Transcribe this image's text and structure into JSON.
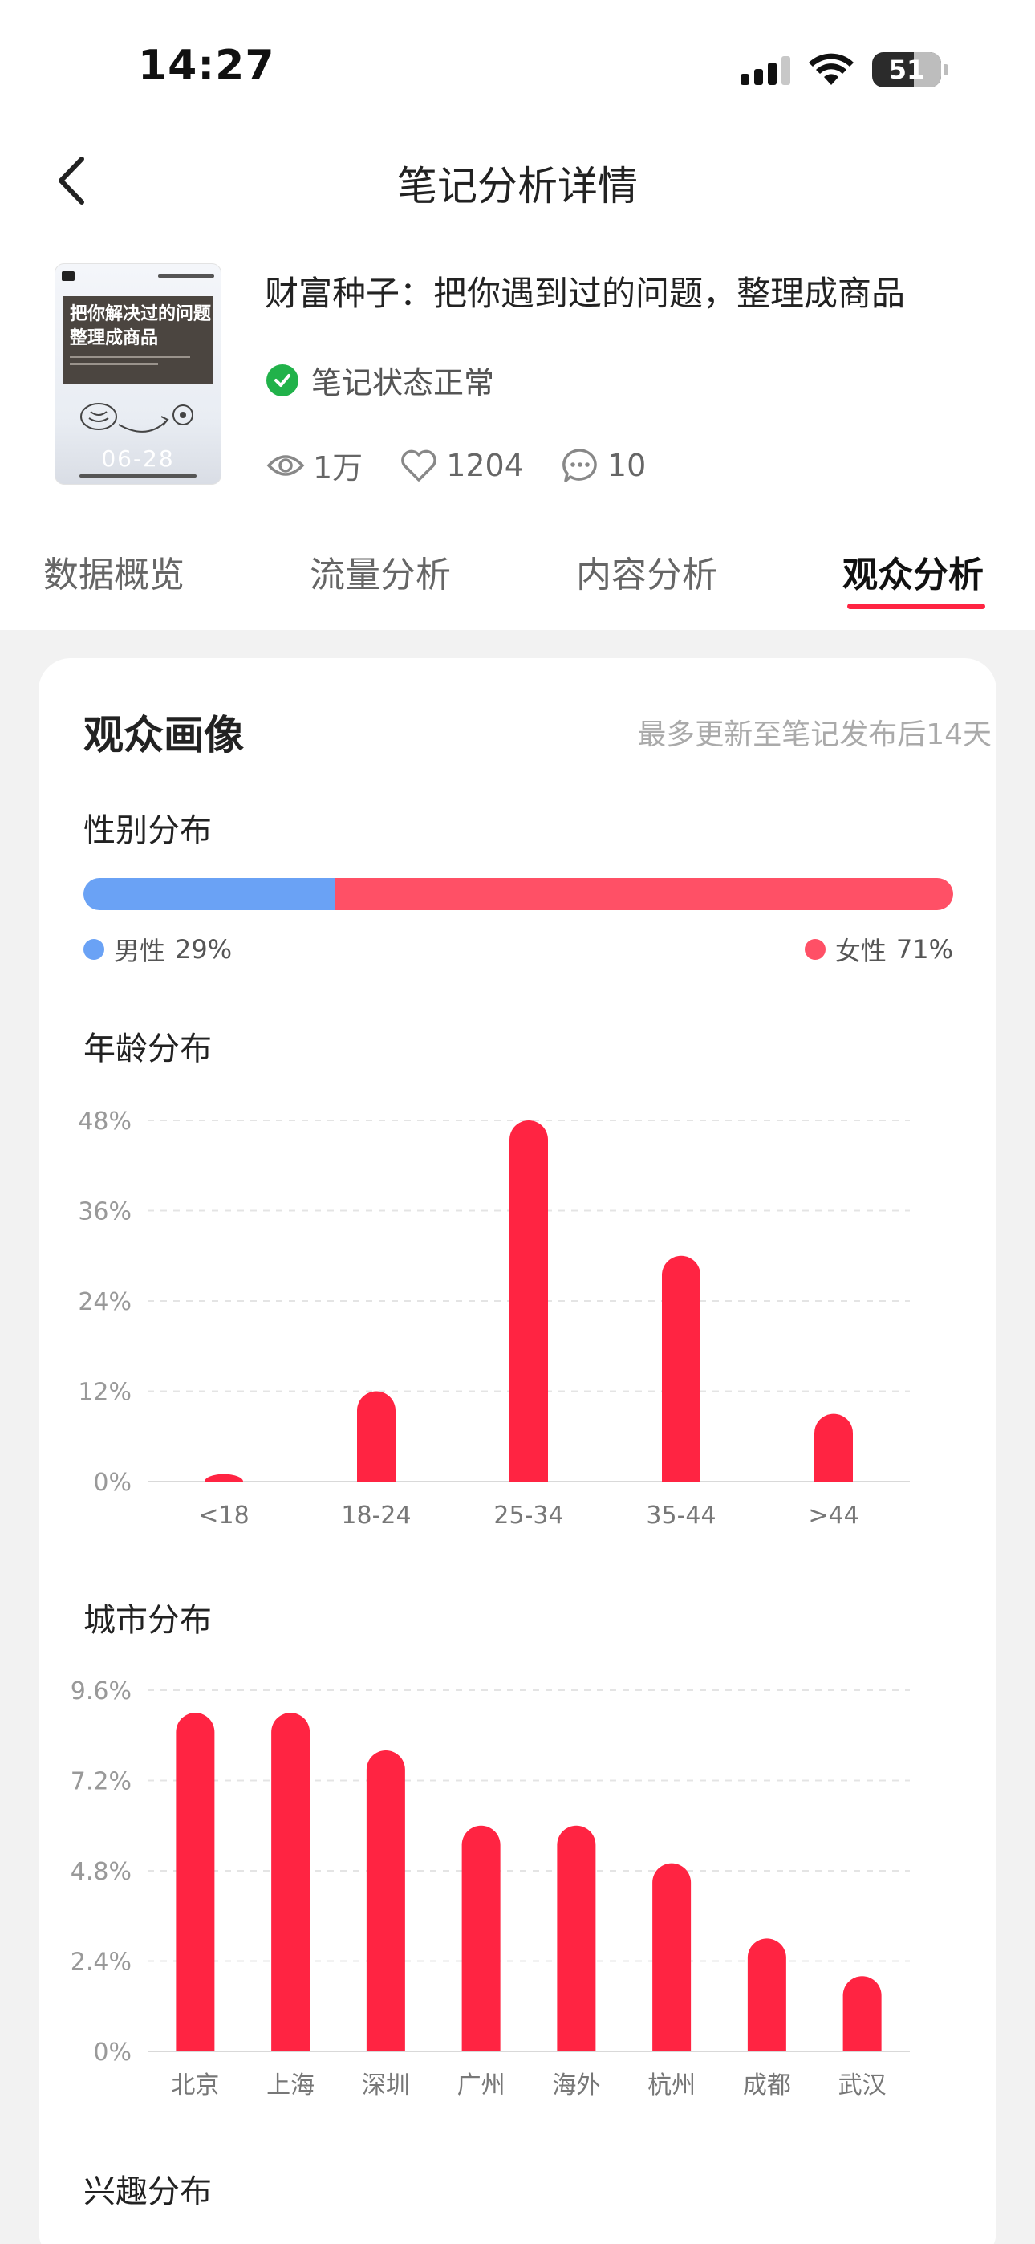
{
  "status_bar": {
    "time": "14:27",
    "battery": "51"
  },
  "nav": {
    "title": "笔记分析详情"
  },
  "note": {
    "title": "财富种子：把你遇到过的问题，整理成商品",
    "status": "笔记状态正常",
    "views": "1万",
    "likes": "1204",
    "comments": "10",
    "cover": {
      "line1": "把你解决过的问题",
      "line2": "整理成商品",
      "date": "06-28"
    }
  },
  "tabs": [
    {
      "label": "数据概览"
    },
    {
      "label": "流量分析"
    },
    {
      "label": "内容分析"
    },
    {
      "label": "观众分析"
    }
  ],
  "active_tab": "观众分析",
  "audience": {
    "title": "观众画像",
    "note": "最多更新至笔记发布后14天",
    "gender_title": "性别分布",
    "male_label": "男性",
    "male_pct": "29%",
    "female_label": "女性",
    "female_pct": "71%",
    "age_title": "年龄分布",
    "city_title": "城市分布",
    "interest_title": "兴趣分布"
  },
  "colors": {
    "accent": "#ff2442",
    "bar": "#ff2442",
    "male": "#6aa2f5",
    "female": "#ff5066",
    "check": "#21b24a"
  },
  "chart_data": [
    {
      "type": "bar",
      "title": "年龄分布",
      "categories": [
        "<18",
        "18-24",
        "25-34",
        "35-44",
        ">44"
      ],
      "values": [
        1,
        12,
        48,
        30,
        9
      ],
      "ylim": [
        0,
        48
      ],
      "yticks": [
        "0%",
        "12%",
        "24%",
        "36%",
        "48%"
      ],
      "grid": true
    },
    {
      "type": "bar",
      "title": "城市分布",
      "categories": [
        "北京",
        "上海",
        "深圳",
        "广州",
        "海外",
        "杭州",
        "成都",
        "武汉"
      ],
      "values": [
        9.0,
        9.0,
        8.0,
        6.0,
        6.0,
        5.0,
        3.0,
        2.0
      ],
      "ylim": [
        0,
        9.6
      ],
      "yticks": [
        "0%",
        "2.4%",
        "4.8%",
        "7.2%",
        "9.6%"
      ],
      "grid": true
    }
  ]
}
